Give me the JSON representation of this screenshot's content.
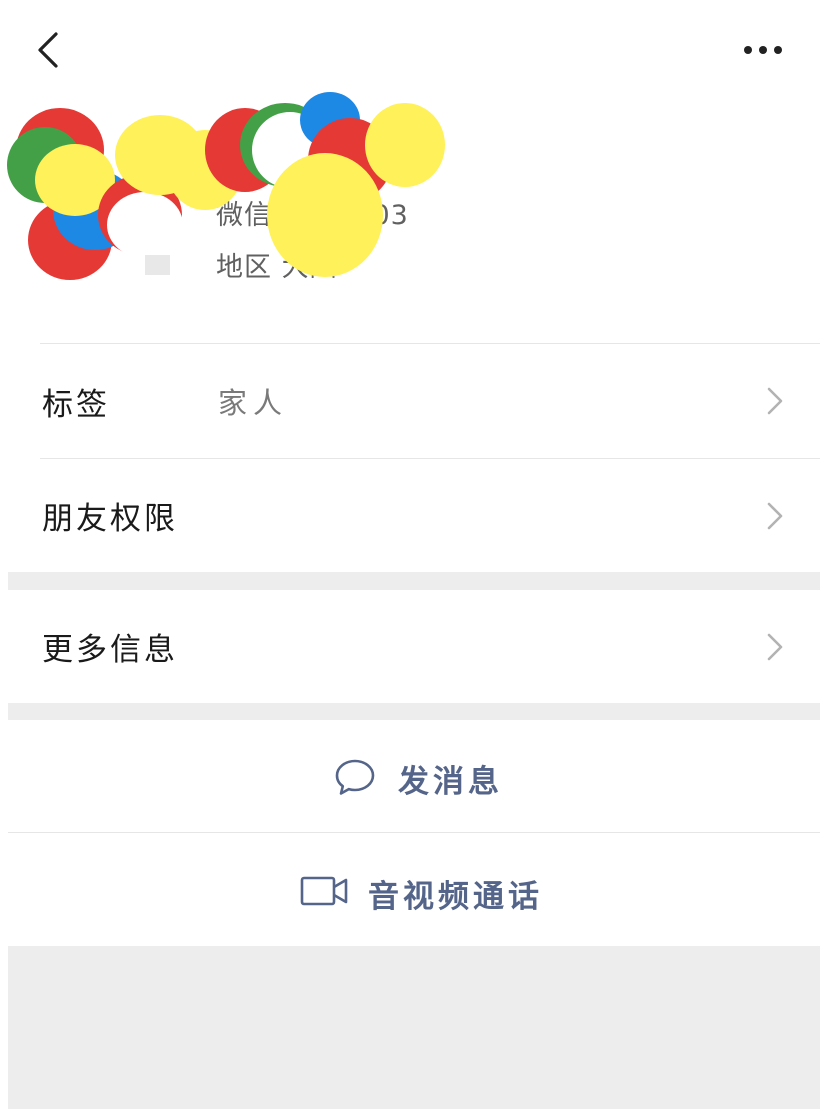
{
  "header": {
    "back_icon": "chevron-left-icon",
    "more_icon": "more-dots-icon"
  },
  "profile": {
    "wxid_visible": "微信 9071203",
    "region_visible": "地区 大陆"
  },
  "menu": {
    "tag": {
      "label": "标签",
      "value": "家人",
      "icon": "chevron-right-icon"
    },
    "friend_permissions": {
      "label": "朋友权限",
      "icon": "chevron-right-icon"
    },
    "more_info": {
      "label": "更多信息",
      "icon": "chevron-right-icon"
    }
  },
  "actions": {
    "send_message": {
      "label": "发消息",
      "icon": "chat-bubble-icon"
    },
    "av_call": {
      "label": "音视频通话",
      "icon": "video-camera-icon"
    }
  },
  "colors": {
    "accent": "#55658a",
    "separator": "#ededed",
    "scribble": [
      "#e53935",
      "#43a047",
      "#1e88e5",
      "#fff159"
    ]
  }
}
